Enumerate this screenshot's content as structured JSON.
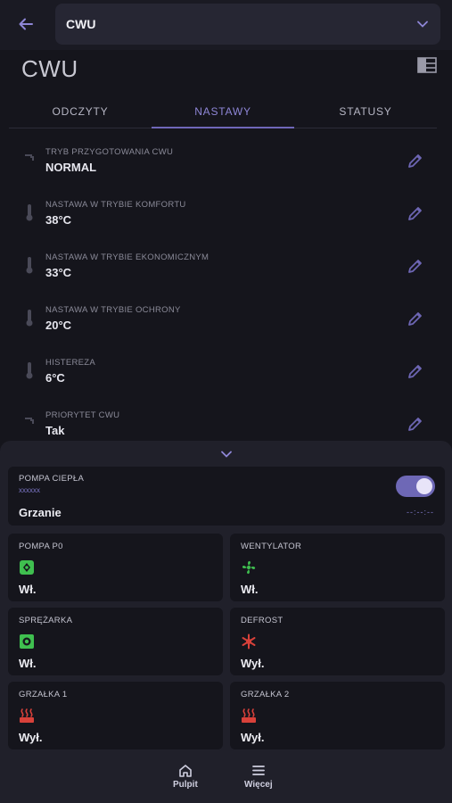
{
  "header": {
    "back_icon": "arrow-left-icon",
    "selector_value": "CWU",
    "selector_icon": "chevron-down-icon"
  },
  "page": {
    "title": "CWU",
    "layout_icon": "grid-layout-icon"
  },
  "tabs": [
    {
      "label": "ODCZYTY",
      "active": false
    },
    {
      "label": "NASTAWY",
      "active": true
    },
    {
      "label": "STATUSY",
      "active": false
    }
  ],
  "settings": [
    {
      "icon": "faucet-icon",
      "label": "TRYB PRZYGOTOWANIA CWU",
      "value": "NORMAL"
    },
    {
      "icon": "thermometer-icon",
      "label": "NASTAWA W TRYBIE KOMFORTU",
      "value": "38°C"
    },
    {
      "icon": "thermometer-icon",
      "label": "NASTAWA W TRYBIE EKONOMICZNYM",
      "value": "33°C"
    },
    {
      "icon": "thermometer-icon",
      "label": "NASTAWA W TRYBIE OCHRONY",
      "value": "20°C"
    },
    {
      "icon": "thermometer-icon",
      "label": "HISTEREZA",
      "value": "6°C"
    },
    {
      "icon": "faucet-icon",
      "label": "PRIORYTET CWU",
      "value": "Tak"
    }
  ],
  "sheet": {
    "collapse_icon": "chevron-down-icon",
    "heat_pump": {
      "title": "POMPA CIEPŁA",
      "subtitle": "xxxxxx",
      "state": "Grzanie",
      "time": "--:--:--",
      "toggle_on": true
    },
    "devices": [
      {
        "title": "POMPA P0",
        "icon": "pump-icon",
        "icon_color": "#3fbf4f",
        "state": "Wł."
      },
      {
        "title": "WENTYLATOR",
        "icon": "fan-icon",
        "icon_color": "#3fbf4f",
        "state": "Wł."
      },
      {
        "title": "SPRĘŻARKA",
        "icon": "compressor-icon",
        "icon_color": "#3fbf4f",
        "state": "Wł."
      },
      {
        "title": "DEFROST",
        "icon": "defrost-icon",
        "icon_color": "#d8413a",
        "state": "Wył."
      },
      {
        "title": "GRZAŁKA 1",
        "icon": "heater-icon",
        "icon_color": "#d8413a",
        "state": "Wył."
      },
      {
        "title": "GRZAŁKA 2",
        "icon": "heater-icon",
        "icon_color": "#d8413a",
        "state": "Wył."
      }
    ]
  },
  "nav": [
    {
      "label": "Pulpit",
      "icon": "home-icon"
    },
    {
      "label": "Więcej",
      "icon": "menu-icon"
    }
  ],
  "colors": {
    "accent": "#6f67b8",
    "on": "#3fbf4f",
    "off": "#d8413a"
  }
}
